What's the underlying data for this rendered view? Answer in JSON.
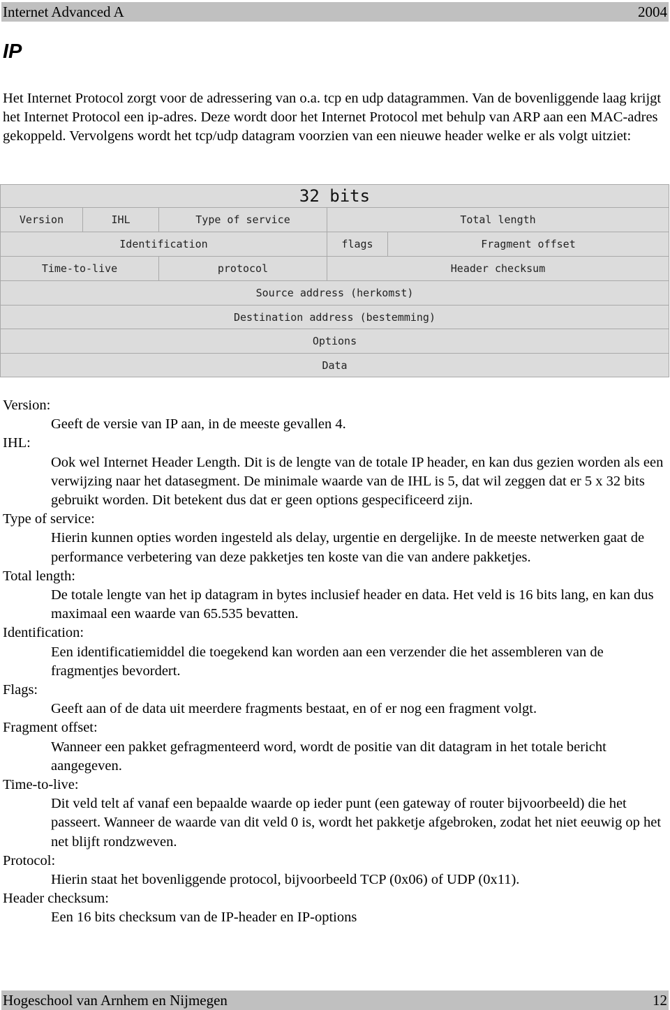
{
  "header": {
    "left": "Internet Advanced A",
    "right": "2004"
  },
  "title": "IP",
  "intro": "Het Internet Protocol zorgt voor de adressering van o.a. tcp en udp datagrammen. Van de bovenliggende laag krijgt het Internet Protocol een ip-adres. Deze wordt door het Internet Protocol met behulp van ARP aan een MAC-adres gekoppeld. Vervolgens wordt het tcp/udp datagram voorzien van een nieuwe header welke er als volgt uitziet:",
  "diagram": {
    "width_label": "32 bits",
    "rows": [
      [
        "Version",
        "IHL",
        "Type of service",
        "Total length"
      ],
      [
        "Identification",
        "flags",
        "Fragment offset"
      ],
      [
        "Time-to-live",
        "protocol",
        "Header checksum"
      ],
      [
        "Source address (herkomst)"
      ],
      [
        "Destination address (bestemming)"
      ],
      [
        "Options"
      ],
      [
        "Data"
      ]
    ]
  },
  "definitions": [
    {
      "term": "Version:",
      "desc": "Geeft de versie van IP aan, in de meeste gevallen 4."
    },
    {
      "term": "IHL:",
      "desc": "Ook wel Internet Header Length. Dit is de lengte van de totale IP header, en kan dus gezien worden als een verwijzing naar het datasegment. De minimale waarde van de IHL is 5, dat wil zeggen dat er 5 x 32 bits gebruikt worden. Dit betekent dus dat er geen options gespecificeerd zijn."
    },
    {
      "term": "Type of service:",
      "desc": "Hierin kunnen opties worden ingesteld als delay, urgentie en dergelijke. In de meeste netwerken gaat de performance verbetering van deze pakketjes ten koste van die van andere pakketjes."
    },
    {
      "term": "Total length:",
      "desc": "De totale lengte van het ip datagram in bytes inclusief header en data. Het veld is 16 bits lang, en kan dus maximaal een waarde van 65.535 bevatten."
    },
    {
      "term": "Identification:",
      "desc": "Een identificatiemiddel die toegekend kan worden aan een verzender die het assembleren van de fragmentjes bevordert."
    },
    {
      "term": "Flags:",
      "desc": "Geeft aan of de data uit meerdere fragments bestaat, en of er nog een fragment volgt."
    },
    {
      "term": "Fragment offset:",
      "desc": "Wanneer een pakket gefragmenteerd word, wordt de positie van dit datagram in het totale bericht aangegeven."
    },
    {
      "term": "Time-to-live:",
      "desc": "Dit veld telt af vanaf een bepaalde waarde op ieder punt (een gateway of router bijvoorbeeld) die het passeert. Wanneer de waarde van dit veld 0 is, wordt het pakketje afgebroken, zodat het niet eeuwig op het net blijft rondzweven."
    },
    {
      "term": "Protocol:",
      "desc": "Hierin staat het bovenliggende protocol, bijvoorbeeld TCP (0x06) of UDP (0x11)."
    },
    {
      "term": "Header checksum:",
      "desc": "Een 16 bits checksum van de IP-header en IP-options"
    }
  ],
  "footer": {
    "left": "Hogeschool van Arnhem en Nijmegen",
    "right": "12"
  }
}
